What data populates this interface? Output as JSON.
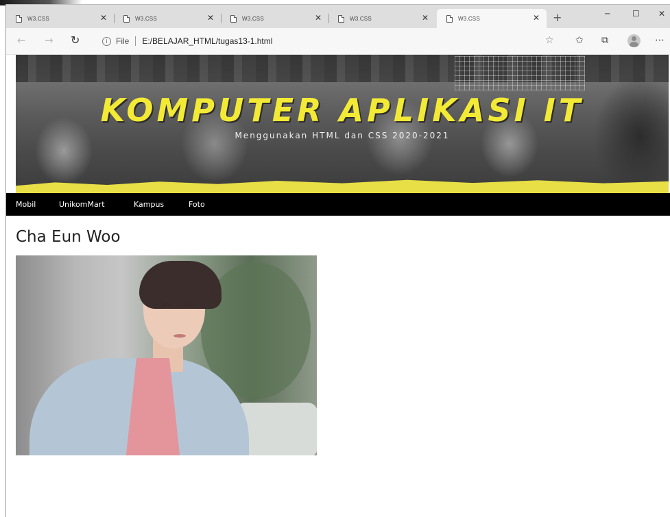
{
  "browser": {
    "tabs": [
      {
        "title": "W3.CSS",
        "active": false
      },
      {
        "title": "W3.CSS",
        "active": false
      },
      {
        "title": "W3.CSS",
        "active": false
      },
      {
        "title": "W3.CSS",
        "active": false
      },
      {
        "title": "W3.CSS",
        "active": true
      }
    ],
    "address": {
      "scheme_label": "File",
      "url": "E:/BELAJAR_HTML/tugas13-1.html"
    },
    "icons": {
      "back": "arrow-left-icon",
      "forward": "arrow-right-icon",
      "reload": "reload-icon",
      "info": "info-icon",
      "favorite": "star-icon",
      "favorites": "favorites-icon",
      "collections": "collections-icon",
      "profile": "avatar-icon",
      "menu": "more-icon"
    }
  },
  "page": {
    "banner": {
      "title": "KOMPUTER APLIKASI IT",
      "subtitle": "Menggunakan HTML dan CSS 2020-2021",
      "title_color": "#f3ea36",
      "stripe_color": "#e7df45"
    },
    "nav": {
      "items": [
        "Mobil",
        "UnikomMart",
        "Kampus",
        "Foto"
      ],
      "background": "#000000"
    },
    "heading": "Cha Eun Woo"
  }
}
